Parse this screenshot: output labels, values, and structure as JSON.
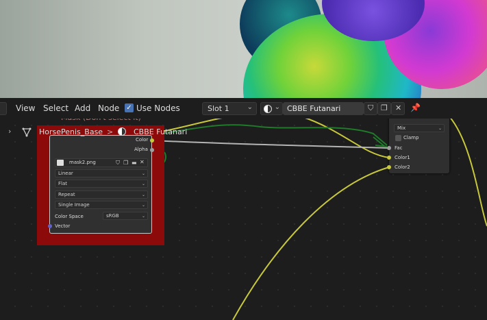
{
  "header": {
    "menu": [
      {
        "label": "View"
      },
      {
        "label": "Select"
      },
      {
        "label": "Add"
      },
      {
        "label": "Node"
      }
    ],
    "use_nodes_label": "Use Nodes",
    "use_nodes_checked": true,
    "slot": "Slot 1",
    "material_name": "CBBE Futanari"
  },
  "breadcrumb": {
    "object": "HorsePenis_Base",
    "separator": ">",
    "material": "CBBE Futanari"
  },
  "frame": {
    "label": "Mask (Don't select it)",
    "color": "#8c0a0a"
  },
  "image_node": {
    "outputs": [
      "Color",
      "Alpha"
    ],
    "image_name": "mask2.png",
    "interpolation": "Linear",
    "projection": "Flat",
    "extension": "Repeat",
    "source": "Single Image",
    "color_space_label": "Color Space",
    "color_space_value": "sRGB",
    "input_vector": "Vector"
  },
  "mix_node": {
    "blend_type": "Mix",
    "clamp_label": "Clamp",
    "inputs": [
      "Fac",
      "Color1",
      "Color2"
    ]
  },
  "colors": {
    "link_yellow": "#c8c83c",
    "link_gray": "#b4b4b4",
    "annotation_green": "#1f7a2a",
    "accent_blue": "#4772b3"
  }
}
